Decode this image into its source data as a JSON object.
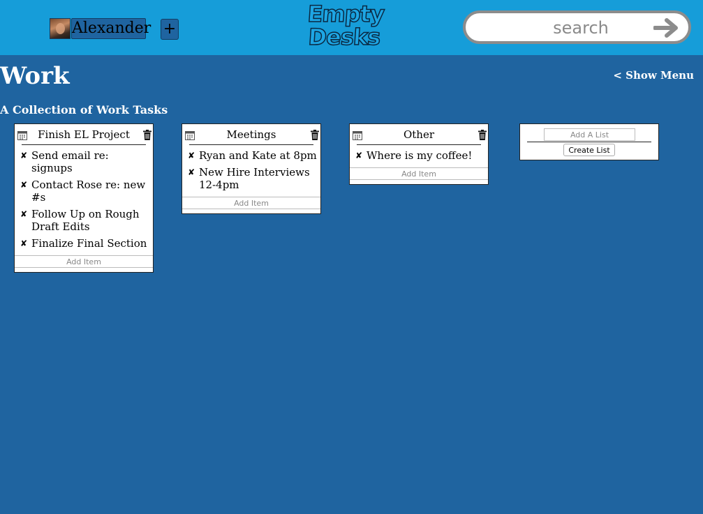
{
  "header": {
    "user_name": "Alexander",
    "add_label": "+",
    "logo_line1": "Empty",
    "logo_line2": "Desks",
    "search_placeholder": "search"
  },
  "page": {
    "title": "Work",
    "show_menu": "< Show Menu",
    "subtitle": "A Collection of Work Tasks"
  },
  "lists": [
    {
      "title": "Finish EL Project",
      "items": [
        "Send email re: signups",
        "Contact Rose re: new #s",
        "Follow Up on Rough Draft Edits",
        "Finalize Final Section"
      ],
      "add_placeholder": "Add Item"
    },
    {
      "title": "Meetings",
      "items": [
        "Ryan and Kate at 8pm",
        "New Hire Interviews 12-4pm"
      ],
      "add_placeholder": "Add Item"
    },
    {
      "title": "Other",
      "items": [
        "Where is my coffee!"
      ],
      "add_placeholder": "Add Item"
    }
  ],
  "new_list": {
    "placeholder": "Add A List",
    "button_label": "Create List"
  },
  "colors": {
    "header_bg": "#169dd9",
    "page_bg": "#1f64a0"
  },
  "icons": {
    "list_left": "calendar-icon",
    "list_right": "trash-icon",
    "item": "x-icon",
    "search": "arrow-right-icon"
  }
}
